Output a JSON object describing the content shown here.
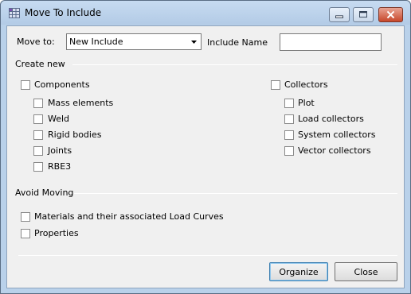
{
  "window": {
    "title": "Move To Include",
    "caption_buttons": {
      "minimize": "▭",
      "maximize": "▣",
      "close": "✕"
    }
  },
  "top_row": {
    "move_to_label": "Move to:",
    "move_to_value": "New Include",
    "include_name_label": "Include Name",
    "include_name_value": ""
  },
  "create_new": {
    "heading": "Create new",
    "components": {
      "label": "Components",
      "checked": false,
      "items": [
        {
          "label": "Mass elements",
          "checked": false
        },
        {
          "label": "Weld",
          "checked": false
        },
        {
          "label": "Rigid bodies",
          "checked": false
        },
        {
          "label": "Joints",
          "checked": false
        },
        {
          "label": "RBE3",
          "checked": false
        }
      ]
    },
    "collectors": {
      "label": "Collectors",
      "checked": false,
      "items": [
        {
          "label": "Plot",
          "checked": false
        },
        {
          "label": "Load collectors",
          "checked": false
        },
        {
          "label": "System collectors",
          "checked": false
        },
        {
          "label": "Vector collectors",
          "checked": false
        }
      ]
    }
  },
  "avoid_moving": {
    "heading": "Avoid Moving",
    "items": [
      {
        "label": "Materials and their associated Load Curves",
        "checked": false
      },
      {
        "label": "Properties",
        "checked": false
      }
    ]
  },
  "buttons": {
    "organize": "Organize",
    "close": "Close"
  },
  "colors": {
    "titlebar": "#b9d1ea",
    "client": "#f0f0f0",
    "close_button": "#c8472b"
  }
}
